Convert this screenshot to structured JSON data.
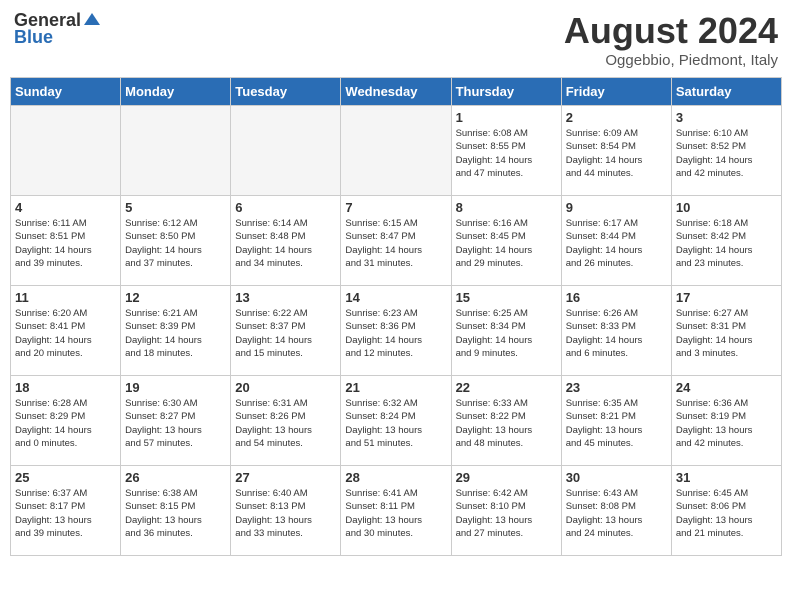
{
  "header": {
    "logo_general": "General",
    "logo_blue": "Blue",
    "month_title": "August 2024",
    "subtitle": "Oggebbio, Piedmont, Italy"
  },
  "days_of_week": [
    "Sunday",
    "Monday",
    "Tuesday",
    "Wednesday",
    "Thursday",
    "Friday",
    "Saturday"
  ],
  "weeks": [
    [
      {
        "day": "",
        "info": "",
        "empty": true
      },
      {
        "day": "",
        "info": "",
        "empty": true
      },
      {
        "day": "",
        "info": "",
        "empty": true
      },
      {
        "day": "",
        "info": "",
        "empty": true
      },
      {
        "day": "1",
        "info": "Sunrise: 6:08 AM\nSunset: 8:55 PM\nDaylight: 14 hours\nand 47 minutes.",
        "empty": false
      },
      {
        "day": "2",
        "info": "Sunrise: 6:09 AM\nSunset: 8:54 PM\nDaylight: 14 hours\nand 44 minutes.",
        "empty": false
      },
      {
        "day": "3",
        "info": "Sunrise: 6:10 AM\nSunset: 8:52 PM\nDaylight: 14 hours\nand 42 minutes.",
        "empty": false
      }
    ],
    [
      {
        "day": "4",
        "info": "Sunrise: 6:11 AM\nSunset: 8:51 PM\nDaylight: 14 hours\nand 39 minutes.",
        "empty": false
      },
      {
        "day": "5",
        "info": "Sunrise: 6:12 AM\nSunset: 8:50 PM\nDaylight: 14 hours\nand 37 minutes.",
        "empty": false
      },
      {
        "day": "6",
        "info": "Sunrise: 6:14 AM\nSunset: 8:48 PM\nDaylight: 14 hours\nand 34 minutes.",
        "empty": false
      },
      {
        "day": "7",
        "info": "Sunrise: 6:15 AM\nSunset: 8:47 PM\nDaylight: 14 hours\nand 31 minutes.",
        "empty": false
      },
      {
        "day": "8",
        "info": "Sunrise: 6:16 AM\nSunset: 8:45 PM\nDaylight: 14 hours\nand 29 minutes.",
        "empty": false
      },
      {
        "day": "9",
        "info": "Sunrise: 6:17 AM\nSunset: 8:44 PM\nDaylight: 14 hours\nand 26 minutes.",
        "empty": false
      },
      {
        "day": "10",
        "info": "Sunrise: 6:18 AM\nSunset: 8:42 PM\nDaylight: 14 hours\nand 23 minutes.",
        "empty": false
      }
    ],
    [
      {
        "day": "11",
        "info": "Sunrise: 6:20 AM\nSunset: 8:41 PM\nDaylight: 14 hours\nand 20 minutes.",
        "empty": false
      },
      {
        "day": "12",
        "info": "Sunrise: 6:21 AM\nSunset: 8:39 PM\nDaylight: 14 hours\nand 18 minutes.",
        "empty": false
      },
      {
        "day": "13",
        "info": "Sunrise: 6:22 AM\nSunset: 8:37 PM\nDaylight: 14 hours\nand 15 minutes.",
        "empty": false
      },
      {
        "day": "14",
        "info": "Sunrise: 6:23 AM\nSunset: 8:36 PM\nDaylight: 14 hours\nand 12 minutes.",
        "empty": false
      },
      {
        "day": "15",
        "info": "Sunrise: 6:25 AM\nSunset: 8:34 PM\nDaylight: 14 hours\nand 9 minutes.",
        "empty": false
      },
      {
        "day": "16",
        "info": "Sunrise: 6:26 AM\nSunset: 8:33 PM\nDaylight: 14 hours\nand 6 minutes.",
        "empty": false
      },
      {
        "day": "17",
        "info": "Sunrise: 6:27 AM\nSunset: 8:31 PM\nDaylight: 14 hours\nand 3 minutes.",
        "empty": false
      }
    ],
    [
      {
        "day": "18",
        "info": "Sunrise: 6:28 AM\nSunset: 8:29 PM\nDaylight: 14 hours\nand 0 minutes.",
        "empty": false
      },
      {
        "day": "19",
        "info": "Sunrise: 6:30 AM\nSunset: 8:27 PM\nDaylight: 13 hours\nand 57 minutes.",
        "empty": false
      },
      {
        "day": "20",
        "info": "Sunrise: 6:31 AM\nSunset: 8:26 PM\nDaylight: 13 hours\nand 54 minutes.",
        "empty": false
      },
      {
        "day": "21",
        "info": "Sunrise: 6:32 AM\nSunset: 8:24 PM\nDaylight: 13 hours\nand 51 minutes.",
        "empty": false
      },
      {
        "day": "22",
        "info": "Sunrise: 6:33 AM\nSunset: 8:22 PM\nDaylight: 13 hours\nand 48 minutes.",
        "empty": false
      },
      {
        "day": "23",
        "info": "Sunrise: 6:35 AM\nSunset: 8:21 PM\nDaylight: 13 hours\nand 45 minutes.",
        "empty": false
      },
      {
        "day": "24",
        "info": "Sunrise: 6:36 AM\nSunset: 8:19 PM\nDaylight: 13 hours\nand 42 minutes.",
        "empty": false
      }
    ],
    [
      {
        "day": "25",
        "info": "Sunrise: 6:37 AM\nSunset: 8:17 PM\nDaylight: 13 hours\nand 39 minutes.",
        "empty": false
      },
      {
        "day": "26",
        "info": "Sunrise: 6:38 AM\nSunset: 8:15 PM\nDaylight: 13 hours\nand 36 minutes.",
        "empty": false
      },
      {
        "day": "27",
        "info": "Sunrise: 6:40 AM\nSunset: 8:13 PM\nDaylight: 13 hours\nand 33 minutes.",
        "empty": false
      },
      {
        "day": "28",
        "info": "Sunrise: 6:41 AM\nSunset: 8:11 PM\nDaylight: 13 hours\nand 30 minutes.",
        "empty": false
      },
      {
        "day": "29",
        "info": "Sunrise: 6:42 AM\nSunset: 8:10 PM\nDaylight: 13 hours\nand 27 minutes.",
        "empty": false
      },
      {
        "day": "30",
        "info": "Sunrise: 6:43 AM\nSunset: 8:08 PM\nDaylight: 13 hours\nand 24 minutes.",
        "empty": false
      },
      {
        "day": "31",
        "info": "Sunrise: 6:45 AM\nSunset: 8:06 PM\nDaylight: 13 hours\nand 21 minutes.",
        "empty": false
      }
    ]
  ]
}
